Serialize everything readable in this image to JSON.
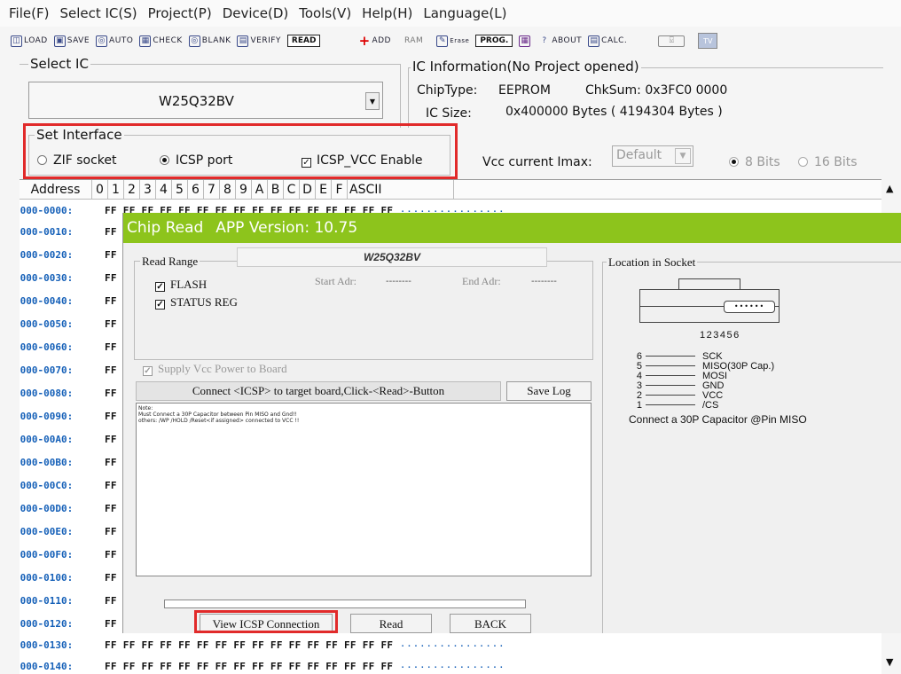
{
  "menu": [
    "File(F)",
    "Select IC(S)",
    "Project(P)",
    "Device(D)",
    "Tools(V)",
    "Help(H)",
    "Language(L)"
  ],
  "toolbar": {
    "load": "LOAD",
    "save": "SAVE",
    "auto": "AUTO",
    "check": "CHECK",
    "blank": "BLANK",
    "verify": "VERIFY",
    "read": "READ",
    "add": "ADD",
    "ram": "RAM",
    "erase": "Erase",
    "prog": "PROG.",
    "about": "ABOUT",
    "calc": "CALC.",
    "tv": "TV"
  },
  "select_ic": {
    "legend": "Select IC",
    "value": "W25Q32BV"
  },
  "ic_info": {
    "legend": "IC Information(No Project opened)",
    "chiptype_label": "ChipType:",
    "chiptype_value": "EEPROM",
    "chksum": "ChkSum: 0x3FC0 0000",
    "size_label": "IC Size:",
    "size_value": "0x400000 Bytes ( 4194304 Bytes )"
  },
  "interface": {
    "legend": "Set Interface",
    "zif": "ZIF socket",
    "icsp": "ICSP port",
    "vcc_enable": "ICSP_VCC Enable",
    "selected": "ICSP port"
  },
  "vcc": {
    "label": "Vcc current Imax:",
    "value": "Default",
    "bits8": "8 Bits",
    "bits16": "16 Bits"
  },
  "hex": {
    "headers": [
      "Address",
      "0",
      "1",
      "2",
      "3",
      "4",
      "5",
      "6",
      "7",
      "8",
      "9",
      "A",
      "B",
      "C",
      "D",
      "E",
      "F",
      "ASCII"
    ],
    "full_row": "FF FF FF FF FF FF FF FF FF FF FF FF FF FF FF FF",
    "partial_byte": "FF F",
    "row120_bytes": "FF F",
    "rows": [
      "0000-0000:",
      "0000-0010:",
      "0000-0020:",
      "0000-0030:",
      "0000-0040:",
      "0000-0050:",
      "0000-0060:",
      "0000-0070:",
      "0000-0080:",
      "0000-0090:",
      "0000-00A0:",
      "0000-00B0:",
      "0000-00C0:",
      "0000-00D0:",
      "0000-00E0:",
      "0000-00F0:",
      "0000-0100:",
      "0000-0110:",
      "0000-0120:",
      "0000-0130:",
      "0000-0140:"
    ],
    "ascii_dots": "................"
  },
  "dialog": {
    "title": "Chip Read",
    "version": "APP Version: 10.75",
    "read_range": "Read Range",
    "chip": "W25Q32BV",
    "flash": "FLASH",
    "status_reg": "STATUS REG",
    "start_label": "Start Adr:",
    "start_value": "--------",
    "end_label": "End Adr:",
    "end_value": "--------",
    "supply": "Supply Vcc Power to Board",
    "instruction": "Connect <ICSP> to target board,Click-<Read>-Button",
    "save_log": "Save Log",
    "log_lines": [
      "Note:",
      "Must Connect a 30P Capacitor between Pin MISO and Gnd!!",
      "others: /WP /HOLD /Reset<if assigned>  connected to VCC !!"
    ],
    "view_icsp": "View ICSP Connection",
    "read_btn": "Read",
    "back_btn": "BACK",
    "location_legend": "Location in Socket",
    "pin_numbers": "123456",
    "pins": [
      {
        "num": "6",
        "name": "SCK"
      },
      {
        "num": "5",
        "name": "MISO(30P Cap.)"
      },
      {
        "num": "4",
        "name": "MOSI"
      },
      {
        "num": "3",
        "name": "GND"
      },
      {
        "num": "2",
        "name": "VCC"
      },
      {
        "num": "1",
        "name": "/CS"
      }
    ],
    "cap_note": "Connect a 30P Capacitor @Pin MISO"
  },
  "colors": {
    "dialog_title": "#8dc41c",
    "highlight": "#e12a2a",
    "address": "#1560b8"
  }
}
